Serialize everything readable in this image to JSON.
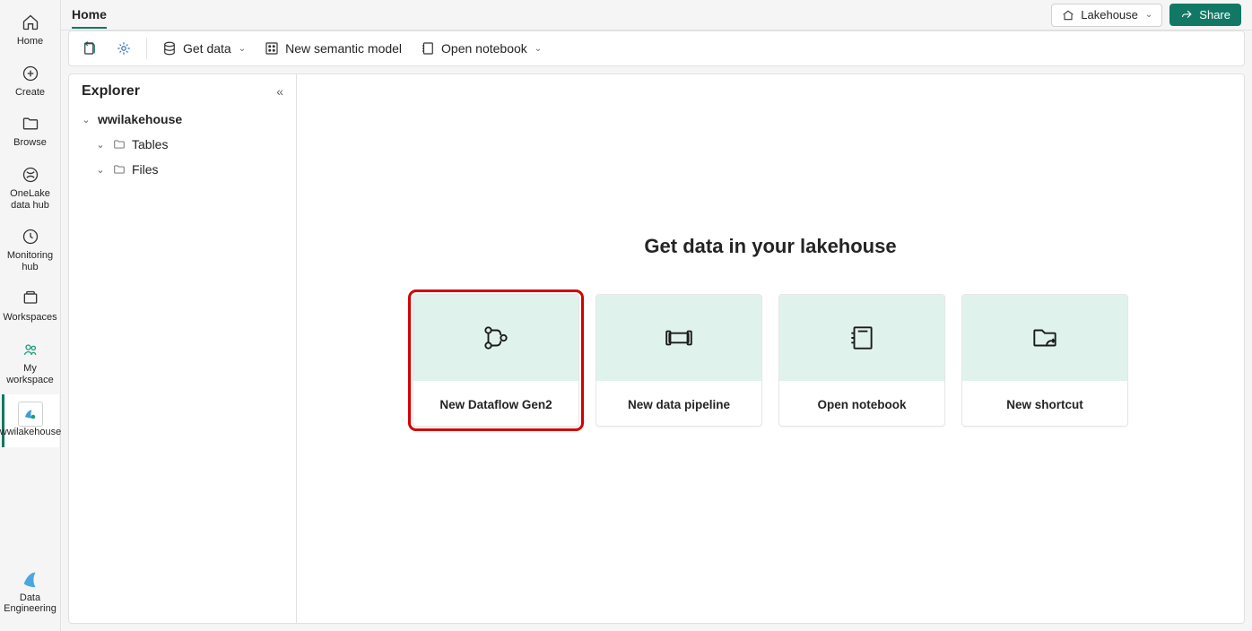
{
  "rail": {
    "home": "Home",
    "create": "Create",
    "browse": "Browse",
    "onelake": "OneLake data hub",
    "monitoring": "Monitoring hub",
    "workspaces": "Workspaces",
    "myworkspace": "My workspace",
    "wwilakehouse": "wwilakehouse",
    "dataeng": "Data Engineering"
  },
  "header": {
    "tab_home": "Home",
    "lakehouse_btn": "Lakehouse",
    "share_btn": "Share"
  },
  "toolbar": {
    "getdata": "Get data",
    "semantic": "New semantic model",
    "notebook": "Open notebook"
  },
  "explorer": {
    "title": "Explorer",
    "root": "wwilakehouse",
    "tables": "Tables",
    "files": "Files"
  },
  "canvas": {
    "heading": "Get data in your lakehouse",
    "cards": [
      {
        "label": "New Dataflow Gen2"
      },
      {
        "label": "New data pipeline"
      },
      {
        "label": "Open notebook"
      },
      {
        "label": "New shortcut"
      }
    ]
  }
}
